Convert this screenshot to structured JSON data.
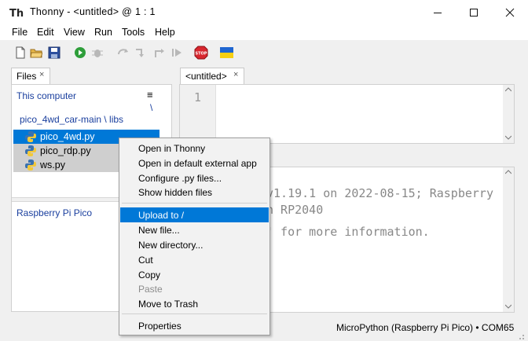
{
  "window": {
    "title": "Thonny  -  <untitled>  @  1 : 1",
    "controls": [
      "minimize-icon",
      "maximize-icon",
      "close-icon"
    ]
  },
  "menubar": [
    "File",
    "Edit",
    "View",
    "Run",
    "Tools",
    "Help"
  ],
  "toolbar": {
    "buttons": [
      "new-file-icon",
      "open-folder-icon",
      "save-icon",
      "run-icon",
      "debug-icon",
      "step-over-icon",
      "step-into-icon",
      "step-out-icon",
      "resume-icon",
      "stop-icon",
      "ukraine-flag-icon"
    ]
  },
  "files": {
    "tab_label": "Files",
    "tab_close": "×",
    "computer_header": "This computer",
    "menu_glyph": "≡",
    "path_trailing": "\\",
    "breadcrumb": "pico_4wd_car-main \\ libs",
    "items": [
      {
        "name": "pico_4wd.py",
        "selected": true
      },
      {
        "name": "pico_rdp.py",
        "selected": true
      },
      {
        "name": "ws.py",
        "selected": true
      }
    ],
    "device_header": "Raspberry Pi Pico"
  },
  "editor": {
    "tab_label": "<untitled>",
    "tab_close": "×",
    "line_number": "1"
  },
  "shell": {
    "lines": [
      "v1.19.1 on 2022-08-15; Raspberry",
      "h RP2040",
      "' for more information."
    ]
  },
  "status": {
    "interpreter": "MicroPython (Raspberry Pi Pico)  •  COM65"
  },
  "context_menu": {
    "items": [
      {
        "label": "Open in Thonny"
      },
      {
        "label": "Open in default external app"
      },
      {
        "label": "Configure .py files..."
      },
      {
        "label": "Show hidden files"
      },
      {
        "label": "Upload to /",
        "highlighted": true
      },
      {
        "label": "New file..."
      },
      {
        "label": "New directory..."
      },
      {
        "label": "Cut"
      },
      {
        "label": "Copy"
      },
      {
        "label": "Paste",
        "disabled": true
      },
      {
        "label": "Move to Trash"
      },
      {
        "label": "Properties"
      }
    ]
  },
  "colors": {
    "accent": "#0078d7",
    "selection": "#0078d7",
    "selection_inactive": "#cfcfcf",
    "link_blue": "#1a3f9e"
  }
}
